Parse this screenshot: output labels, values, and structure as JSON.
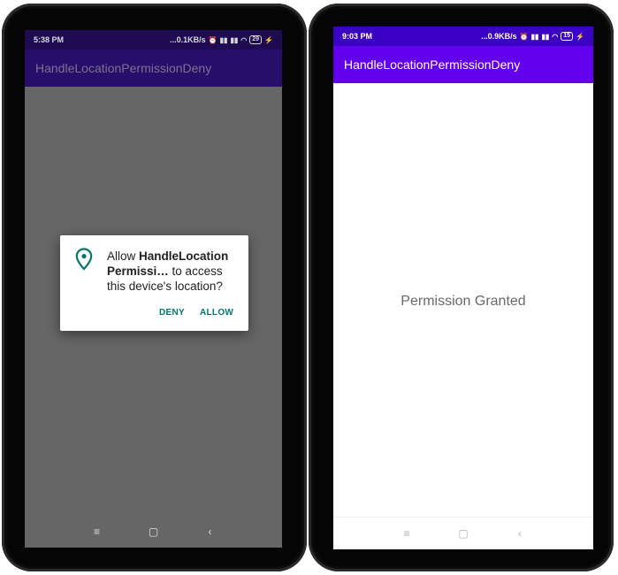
{
  "left_phone": {
    "status": {
      "time": "5:38 PM",
      "net_speed": "...0.1KB/s",
      "battery": "29",
      "icons": [
        "alarm-icon",
        "signal-icon",
        "signal-icon",
        "wifi-icon",
        "battery-icon",
        "charging-icon"
      ]
    },
    "appbar": {
      "title": "HandleLocationPermissionDeny"
    },
    "dialog": {
      "icon": "location-pin-icon",
      "text_prefix": "Allow ",
      "app_name": "HandleLocation Permissi…",
      "text_suffix": " to access this device's location?",
      "deny_label": "DENY",
      "allow_label": "ALLOW",
      "accent_color": "#00796b"
    },
    "navbar": {
      "menu": "≡",
      "home": "▢",
      "back": "‹"
    }
  },
  "right_phone": {
    "status": {
      "time": "9:03 PM",
      "net_speed": "...0.9KB/s",
      "battery": "15",
      "icons": [
        "alarm-icon",
        "signal-icon",
        "signal-icon",
        "wifi-icon",
        "battery-icon",
        "charging-icon"
      ]
    },
    "appbar": {
      "title": "HandleLocationPermissionDeny",
      "color": "#6200ee"
    },
    "content": {
      "message": "Permission Granted"
    },
    "navbar": {
      "menu": "≡",
      "home": "▢",
      "back": "‹"
    }
  }
}
